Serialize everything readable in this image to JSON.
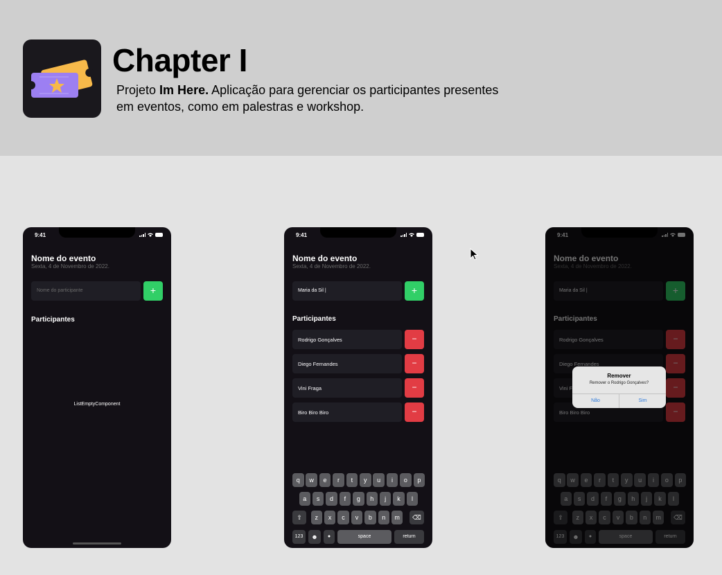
{
  "header": {
    "title": "Chapter I",
    "desc_prefix": "Projeto ",
    "desc_bold": "Im Here.",
    "desc_rest": " Aplicação para gerenciar os participantes presentes em eventos, como em palestras e workshop.",
    "icon": "ticket-star-icon"
  },
  "status": {
    "time": "9:41"
  },
  "event": {
    "title": "Nome do evento",
    "date": "Sexta, 4 de Novembro de 2022."
  },
  "screen1": {
    "placeholder": "Nome do participante",
    "add_label": "+",
    "list_title": "Participantes",
    "empty_text": "ListEmptyComponent"
  },
  "screen2": {
    "input_value": "Maria da Sil |",
    "add_label": "+",
    "list_title": "Participantes",
    "participants": [
      "Rodrigo Gonçalves",
      "Diego Fernandes",
      "Vini Fraga",
      "Biro Biro Biro"
    ],
    "remove_label": "−"
  },
  "keyboard": {
    "row1": [
      "q",
      "w",
      "e",
      "r",
      "t",
      "y",
      "u",
      "i",
      "o",
      "p"
    ],
    "row2": [
      "a",
      "s",
      "d",
      "f",
      "g",
      "h",
      "j",
      "k",
      "l"
    ],
    "row3": [
      "z",
      "x",
      "c",
      "v",
      "b",
      "n",
      "m"
    ],
    "num": "123",
    "space": "space",
    "return": "return"
  },
  "alert": {
    "title": "Remover",
    "message": "Remover o Rodrigo Gonçalves?",
    "no": "Não",
    "yes": "Sim"
  },
  "colors": {
    "accent_green": "#31cf67",
    "danger_red": "#e23c44",
    "background": "#131016",
    "input_bg": "#1f1e25"
  }
}
